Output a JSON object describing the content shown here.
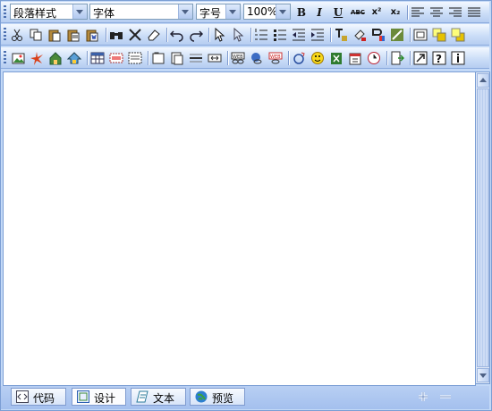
{
  "toolbar1": {
    "paragraph_style": "段落样式",
    "font": "字体",
    "font_size": "字号",
    "zoom": "100%",
    "bold": "B",
    "italic": "I",
    "underline": "U",
    "strikethrough": "ABC",
    "superscript": "x²",
    "subscript": "x₂"
  },
  "tabs": [
    {
      "label": "代码",
      "icon": "code-icon"
    },
    {
      "label": "设计",
      "icon": "design-icon"
    },
    {
      "label": "文本",
      "icon": "text-icon"
    },
    {
      "label": "预览",
      "icon": "preview-globe-icon"
    }
  ],
  "active_tab": "设计",
  "colors": {
    "accent": "#a9c6f0",
    "toolbar": "#c9dcf7",
    "border": "#7b9ed4"
  }
}
